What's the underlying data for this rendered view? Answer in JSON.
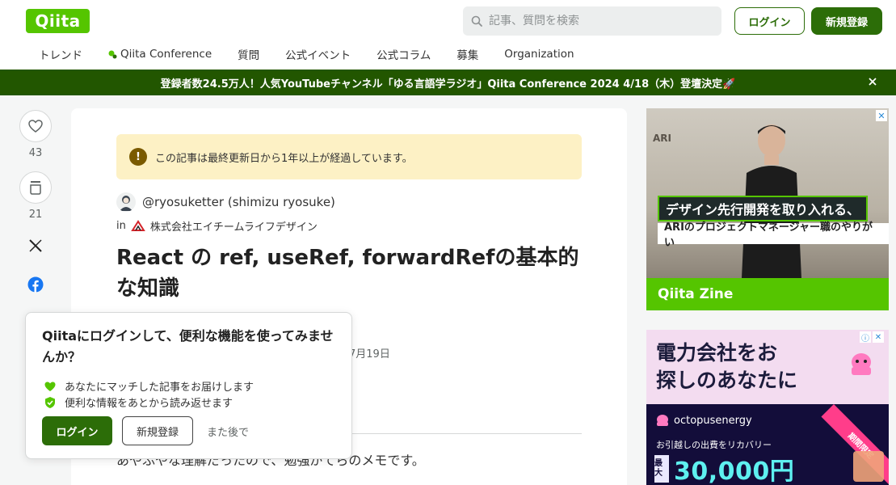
{
  "header": {
    "logo_text": "Qiita",
    "search_placeholder": "記事、質問を検索",
    "login_label": "ログイン",
    "signup_label": "新規登録",
    "nav": [
      "トレンド",
      "Qiita Conference",
      "質問",
      "公式イベント",
      "公式コラム",
      "募集",
      "Organization"
    ]
  },
  "announcement": {
    "text": "登録者数24.5万人！人気YouTubeチャンネル「ゆる言語学ラジオ」Qiita Conference 2024 4/18（木）登壇決定🚀"
  },
  "actions": {
    "likes": "43",
    "stocks": "21"
  },
  "article": {
    "notice": "この記事は最終更新日から1年以上が経過しています。",
    "author": "@ryosuketter (shimizu ryosuke)",
    "org_prefix": "in",
    "organization": "株式会社エイチームライフデザイン",
    "title": "React の ref, useRef, forwardRefの基本的な知識",
    "date_fragment": "7月19日",
    "body_start": "あやふやな理解だったので、勉強がてらのメモです。"
  },
  "popup": {
    "title": "Qiitaにログインして、便利な機能を使ってみませんか？",
    "feature1": "あなたにマッチした記事をお届けします",
    "feature2": "便利な情報をあとから読み返せます",
    "login_label": "ログイン",
    "signup_label": "新規登録",
    "later_label": "また後で"
  },
  "ads": {
    "zine": {
      "caption1": "デザイン先行開発を取り入れる、",
      "caption2": "ARIのプロジェクトマネージャー職のやりがい",
      "brand": "Qiita Zine",
      "sign": "ARI"
    },
    "octopus": {
      "headline1": "電力会社をお",
      "headline2": "探しのあなたに",
      "brand": "octopusenergy",
      "sub": "お引越しの出費をリカバリー",
      "tag": "最大",
      "amount": "30,000円",
      "ribbon": "期間限定"
    }
  },
  "colors": {
    "brand_green": "#55c500",
    "dark_green": "#2c6d08",
    "banner_green": "#225600",
    "notice_yellow": "#fdf1c5"
  }
}
